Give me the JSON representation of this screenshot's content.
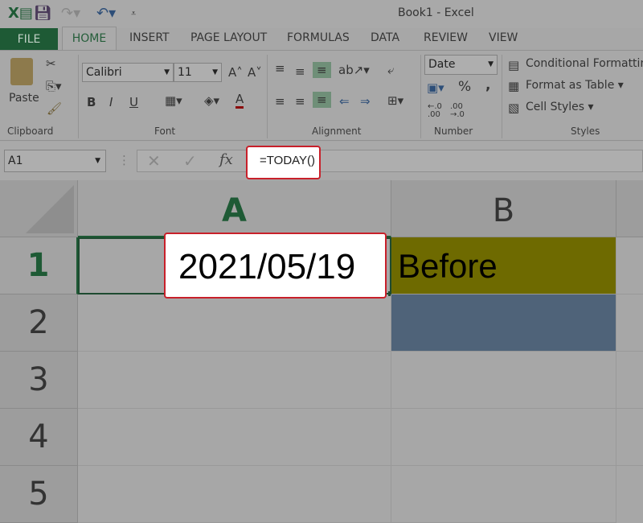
{
  "window": {
    "title": "Book1 - Excel"
  },
  "quick_access": [
    "excel-logo-icon",
    "save-icon",
    "redo-icon",
    "undo-icon",
    "customize-icon"
  ],
  "tabs": [
    "FILE",
    "HOME",
    "INSERT",
    "PAGE LAYOUT",
    "FORMULAS",
    "DATA",
    "REVIEW",
    "VIEW"
  ],
  "ribbon": {
    "clipboard": {
      "label": "Clipboard",
      "paste": "Paste"
    },
    "font": {
      "label": "Font",
      "name": "Calibri",
      "size": "11",
      "bold": "B",
      "italic": "I",
      "underline": "U"
    },
    "alignment": {
      "label": "Alignment"
    },
    "number": {
      "label": "Number",
      "format": "Date",
      "percent": "%",
      "comma": ","
    },
    "styles": {
      "label": "Styles",
      "conditional": "Conditional Formatting",
      "format_table": "Format as Table",
      "cell_styles": "Cell Styles"
    }
  },
  "formula_bar": {
    "name_box": "A1",
    "fx": "fx",
    "formula": "=TODAY()"
  },
  "grid": {
    "columns": [
      "A",
      "B"
    ],
    "rows": [
      "1",
      "2",
      "3",
      "4",
      "5"
    ],
    "cells": {
      "A1": "2021/05/19",
      "B1": "Before"
    },
    "colors": {
      "B1": "#6e6a00",
      "B2": "#4f6379",
      "highlight": "#c8202a",
      "selected_header": "#1e5a35"
    }
  }
}
